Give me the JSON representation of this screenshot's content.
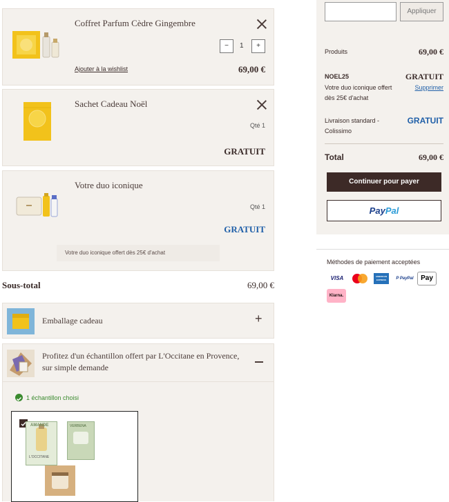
{
  "cart": {
    "items": [
      {
        "name": "Coffret Parfum Cèdre Gingembre",
        "quantity": "1",
        "minus": "−",
        "plus": "+",
        "wishlist": "Ajouter à la wishlist",
        "price": "69,00 €"
      },
      {
        "name": "Sachet Cadeau Noël",
        "qty_label": "Qté 1",
        "price": "GRATUIT"
      },
      {
        "name": "Votre duo iconique",
        "qty_label": "Qté 1",
        "price": "GRATUIT",
        "note": "Votre duo iconique offert dès 25€ d'achat"
      }
    ],
    "subtotal_label": "Sous-total",
    "subtotal_value": "69,00 €",
    "gift_wrap": {
      "label": "Emballage cadeau",
      "toggle": "+"
    },
    "sample": {
      "label_line1": "Profitez d'un échantillon offert par L'Occitane en Provence,",
      "label_line2": "sur simple demande",
      "toggle": "—",
      "chosen": "1 échantillon choisi",
      "product_text": "AMANDE",
      "brand_text": "L'OCCITANE",
      "card_text": "VERBENA"
    }
  },
  "summary": {
    "promo_placeholder": "",
    "apply_label": "Appliquer",
    "products_label": "Produits",
    "products_value": "69,00 €",
    "code": "NOEL25",
    "code_value": "GRATUIT",
    "code_desc_line1": "Votre duo iconique offert",
    "code_desc_line2": "dès 25€ d'achat",
    "remove_label": "Supprimer",
    "shipping_line1": "Livraison standard -",
    "shipping_line2": "Colissimo",
    "shipping_value": "GRATUIT",
    "total_label": "Total",
    "total_value": "69,00 €",
    "continue_label": "Continuer pour payer",
    "paypal_label_1": "Pay",
    "paypal_label_2": "Pal"
  },
  "payment": {
    "title": "Méthodes de paiement acceptées",
    "methods": [
      "VISA",
      "Mastercard",
      "AMEX",
      "PayPal",
      "Apple Pay",
      "Klarna."
    ],
    "visa": "VISA",
    "amex": "AMERICAN EXPRESS",
    "paypal_small": "P PayPal",
    "applepay": "Pay",
    "klarna": "Klarna."
  },
  "colors": {
    "accent_blue": "#1f5fa8",
    "dark_button": "#3d2a27",
    "panel": "#f4f1ed",
    "check_green": "#3a8a2e"
  }
}
